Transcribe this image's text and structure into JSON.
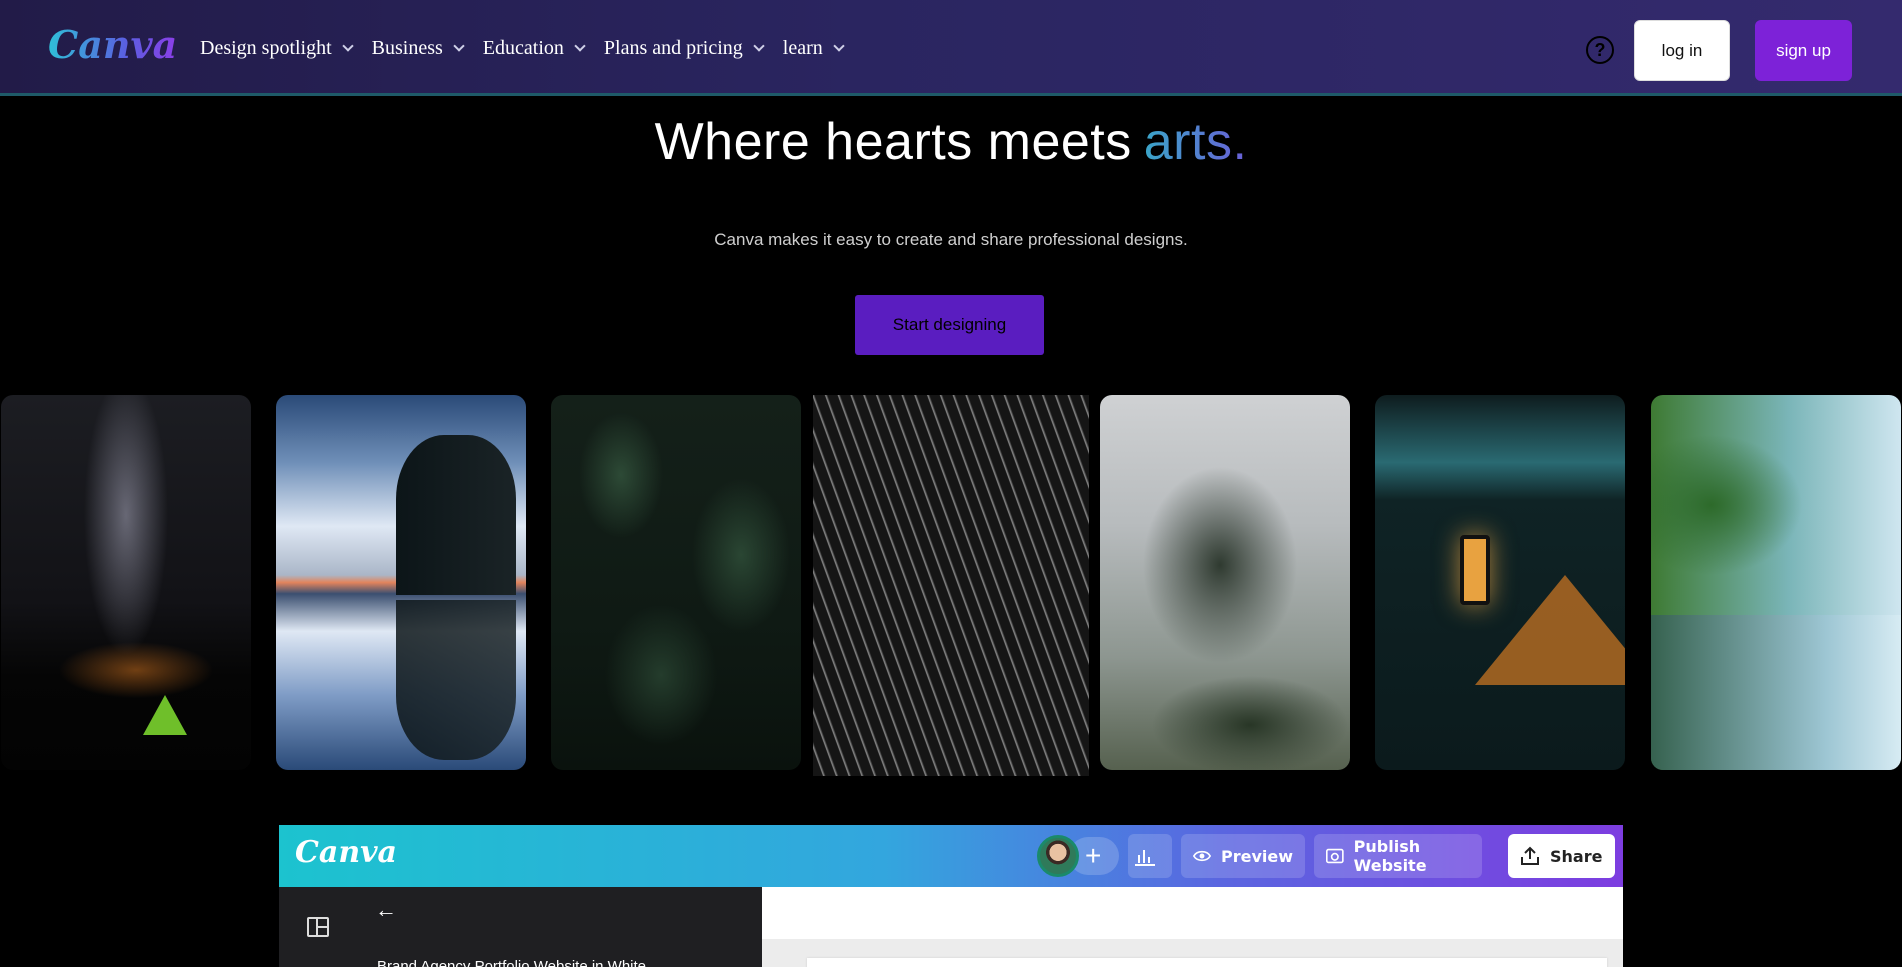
{
  "nav": {
    "logo": "Canva",
    "menu": [
      {
        "label": "Design spotlight"
      },
      {
        "label": "Business"
      },
      {
        "label": "Education"
      },
      {
        "label": "Plans and pricing"
      },
      {
        "label": "learn"
      }
    ],
    "help_icon": "?",
    "login_label": "log in",
    "signup_label": "sign up"
  },
  "hero": {
    "headline": "Where hearts meets",
    "headline_accent": "arts.",
    "subtitle": "Canva makes it easy to create and share professional designs.",
    "cta_label": "Start designing"
  },
  "gallery": [
    {
      "name": "night-sky-tent-image"
    },
    {
      "name": "lake-reflection-image"
    },
    {
      "name": "fern-leaves-image"
    },
    {
      "name": "wavy-lines-image"
    },
    {
      "name": "misty-forest-image"
    },
    {
      "name": "street-lantern-image"
    },
    {
      "name": "foggy-lake-image"
    }
  ],
  "editor": {
    "logo": "Canva",
    "plus": "+",
    "preview_label": "Preview",
    "publish_label": "Publish Website",
    "share_label": "Share",
    "back_arrow": "←",
    "design_name": "Brand Agency Portfolio Website in White"
  },
  "colors": {
    "accent_purple": "#7d22d8",
    "cta_purple": "#5a1dc0",
    "nav_bg": "#2a2560"
  }
}
